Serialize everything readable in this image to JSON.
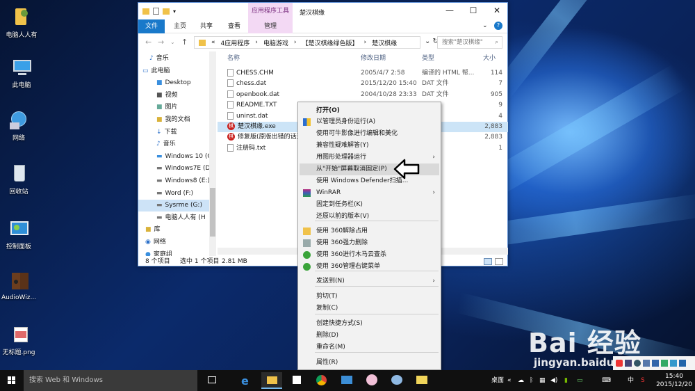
{
  "desktop": {
    "icons": [
      {
        "label": "电脑人人有"
      },
      {
        "label": "此电脑"
      },
      {
        "label": "网络"
      },
      {
        "label": "回收站"
      },
      {
        "label": "控制面板"
      },
      {
        "label": "AudioWiz..."
      },
      {
        "label": "无标题.png"
      }
    ]
  },
  "explorer": {
    "contextual_group": "应用程序工具",
    "window_title": "楚汉棋缘",
    "ribbon_tabs": {
      "file": "文件",
      "home": "主页",
      "share": "共享",
      "view": "查看",
      "manage": "管理"
    },
    "breadcrumb": {
      "prefix": "«",
      "parts": [
        "4应用程序",
        "电脑游戏",
        "【楚汉棋缘绿色版】",
        "楚汉棋缘"
      ]
    },
    "search_placeholder": "搜索\"楚汉棋缘\"",
    "nav_items": [
      {
        "label": "音乐"
      },
      {
        "label": "此电脑"
      },
      {
        "label": "Desktop"
      },
      {
        "label": "视频"
      },
      {
        "label": "图片"
      },
      {
        "label": "我的文档"
      },
      {
        "label": "下载"
      },
      {
        "label": "音乐"
      },
      {
        "label": "Windows 10 (C"
      },
      {
        "label": "Windows7E (D"
      },
      {
        "label": "Windows8 (E:)"
      },
      {
        "label": "Word (F:)"
      },
      {
        "label": "Sysrme (G:)"
      },
      {
        "label": "电脑人人有 (H"
      },
      {
        "label": "库"
      },
      {
        "label": "网络"
      },
      {
        "label": "家庭组"
      }
    ],
    "columns": {
      "name": "名称",
      "date": "修改日期",
      "type": "类型",
      "size": "大小"
    },
    "files": [
      {
        "name": "CHESS.CHM",
        "date": "2005/4/7 2:58",
        "type": "编译的 HTML 帮...",
        "size": "114"
      },
      {
        "name": "chess.dat",
        "date": "2015/12/20 15:40",
        "type": "DAT 文件",
        "size": "7"
      },
      {
        "name": "openbook.dat",
        "date": "2004/10/28 23:33",
        "type": "DAT 文件",
        "size": "905"
      },
      {
        "name": "README.TXT",
        "date": "",
        "type": "",
        "size": "9"
      },
      {
        "name": "uninst.dat",
        "date": "",
        "type": "",
        "size": "4"
      },
      {
        "name": "楚汉棋缘.exe",
        "date": "",
        "type": "序",
        "size": "2,883"
      },
      {
        "name": "修复版(原版出错的话选",
        "date": "",
        "type": "序",
        "size": "2,883"
      },
      {
        "name": "注册码.txt",
        "date": "",
        "type": "",
        "size": "1"
      }
    ],
    "status": {
      "count": "8 个项目",
      "selected": "选中 1 个项目",
      "size": "2.81 MB"
    }
  },
  "context_menu": {
    "items": [
      {
        "label": "打开(O)"
      },
      {
        "label": "以管理员身份运行(A)"
      },
      {
        "label": "使用可牛影像进行编辑和美化"
      },
      {
        "label": "兼容性疑难解答(Y)"
      },
      {
        "label": "用图形处理器运行"
      },
      {
        "label": "从\"开始\"屏幕取消固定(P)"
      },
      {
        "label": "使用 Windows Defender扫描..."
      },
      {
        "label": "WinRAR"
      },
      {
        "label": "固定到任务栏(K)"
      },
      {
        "label": "还原以前的版本(V)"
      },
      {
        "label": "使用 360解除占用"
      },
      {
        "label": "使用 360强力删除"
      },
      {
        "label": "使用 360进行木马云查杀"
      },
      {
        "label": "使用 360管理右键菜单"
      },
      {
        "label": "发送到(N)"
      },
      {
        "label": "剪切(T)"
      },
      {
        "label": "复制(C)"
      },
      {
        "label": "创建快捷方式(S)"
      },
      {
        "label": "删除(D)"
      },
      {
        "label": "重命名(M)"
      },
      {
        "label": "属性(R)"
      }
    ]
  },
  "taskbar": {
    "search_placeholder": "搜索 Web 和 Windows",
    "desktop_label": "桌面",
    "ime_label": "中",
    "time": "15:40",
    "date": "2015/12/20"
  },
  "watermark": {
    "logo": "Bai 经验",
    "url": "jingyan.baidu.com"
  },
  "colors": {
    "accent": "#1979ca",
    "contextual": "#f3d9f4",
    "selection": "#cce4f7"
  }
}
